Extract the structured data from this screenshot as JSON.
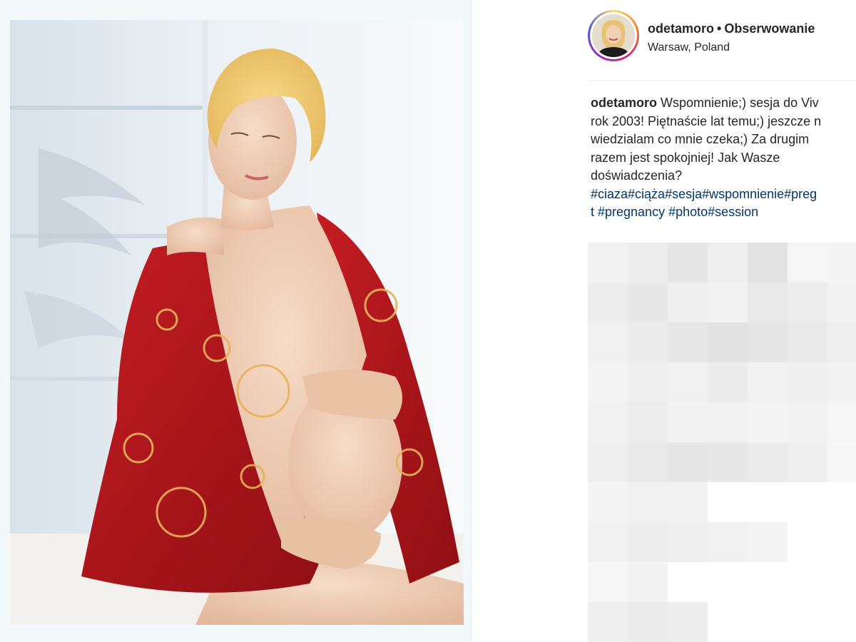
{
  "post": {
    "username": "odetamoro",
    "separator": "•",
    "follow_label": "Obserwowanie",
    "location": "Warsaw, Poland"
  },
  "caption": {
    "username": "odetamoro",
    "lines": [
      "Wspomnienie;) sesja do Viv",
      "rok 2003! Piętnaście lat temu;) jeszcze n",
      "wiedzialam co mnie czeka;) Za drugim",
      "razem jest spokojniej! Jak Wasze",
      "doświadczenia?"
    ],
    "hashtags_line1": "#ciaza#ciąża#sesja#wspomnienie#preg",
    "hashtags_line2": "t #pregnancy #photo#session"
  },
  "colors": {
    "text": "#262626",
    "hashtag": "#003569",
    "robe": "#b3161c",
    "hair": "#f0c870"
  },
  "icons": {
    "avatar": "profile-photo",
    "photo": "post-photo"
  }
}
